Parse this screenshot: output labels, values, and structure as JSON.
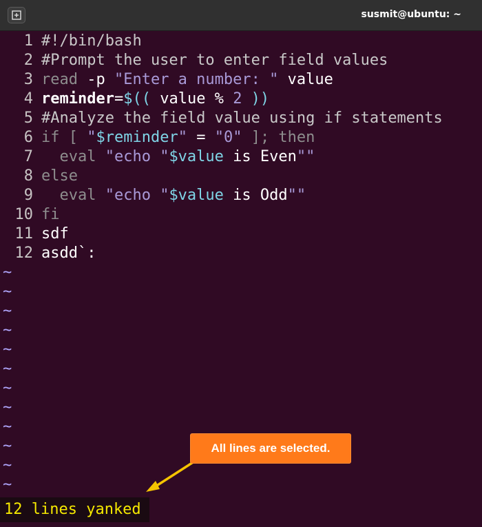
{
  "titlebar": {
    "title": "susmit@ubuntu: ~",
    "new_tab_icon": "new-tab-icon"
  },
  "code": {
    "lines": [
      {
        "num": "1",
        "parts": [
          {
            "t": "#!/bin/bash",
            "c": "comment"
          }
        ]
      },
      {
        "num": "2",
        "parts": [
          {
            "t": "#Prompt the user to enter field values",
            "c": "comment"
          }
        ]
      },
      {
        "num": "3",
        "parts": [
          {
            "t": "read",
            "c": "kw"
          },
          {
            "t": " -p ",
            "c": "op"
          },
          {
            "t": "\"Enter a number: \"",
            "c": "str"
          },
          {
            "t": " value",
            "c": "op"
          }
        ]
      },
      {
        "num": "4",
        "parts": [
          {
            "t": "reminder",
            "c": "bold"
          },
          {
            "t": "=",
            "c": "op"
          },
          {
            "t": "$((",
            "c": "var"
          },
          {
            "t": " value % ",
            "c": "op"
          },
          {
            "t": "2",
            "c": "num"
          },
          {
            "t": " ))",
            "c": "var"
          }
        ]
      },
      {
        "num": "5",
        "parts": [
          {
            "t": "#Analyze the field value using if statements",
            "c": "comment"
          }
        ]
      },
      {
        "num": "6",
        "parts": [
          {
            "t": "if [ ",
            "c": "kw"
          },
          {
            "t": "\"",
            "c": "str"
          },
          {
            "t": "$reminder",
            "c": "var"
          },
          {
            "t": "\"",
            "c": "str"
          },
          {
            "t": " = ",
            "c": "op"
          },
          {
            "t": "\"0\"",
            "c": "str"
          },
          {
            "t": " ]; then",
            "c": "kw"
          }
        ]
      },
      {
        "num": "7",
        "parts": [
          {
            "t": "  eval ",
            "c": "kw"
          },
          {
            "t": "\"echo \"",
            "c": "str"
          },
          {
            "t": "$value",
            "c": "var"
          },
          {
            "t": " is Even",
            "c": "op"
          },
          {
            "t": "\"\"",
            "c": "str"
          }
        ]
      },
      {
        "num": "8",
        "parts": [
          {
            "t": "else",
            "c": "kw"
          }
        ]
      },
      {
        "num": "9",
        "parts": [
          {
            "t": "  eval ",
            "c": "kw"
          },
          {
            "t": "\"echo \"",
            "c": "str"
          },
          {
            "t": "$value",
            "c": "var"
          },
          {
            "t": " is Odd",
            "c": "op"
          },
          {
            "t": "\"\"",
            "c": "str"
          }
        ]
      },
      {
        "num": "10",
        "parts": [
          {
            "t": "fi",
            "c": "kw"
          }
        ]
      },
      {
        "num": "11",
        "parts": [
          {
            "t": "sdf",
            "c": "op"
          }
        ]
      },
      {
        "num": "12",
        "parts": [
          {
            "t": "asdd`:",
            "c": "op"
          }
        ]
      }
    ],
    "empty_line_marker": "~",
    "empty_line_count": 12
  },
  "status": {
    "message": "12 lines yanked"
  },
  "annotation": {
    "text": "All lines are selected."
  },
  "colors": {
    "background": "#300a24",
    "status_text": "#f5e800",
    "callout": "#ff7a1a"
  }
}
